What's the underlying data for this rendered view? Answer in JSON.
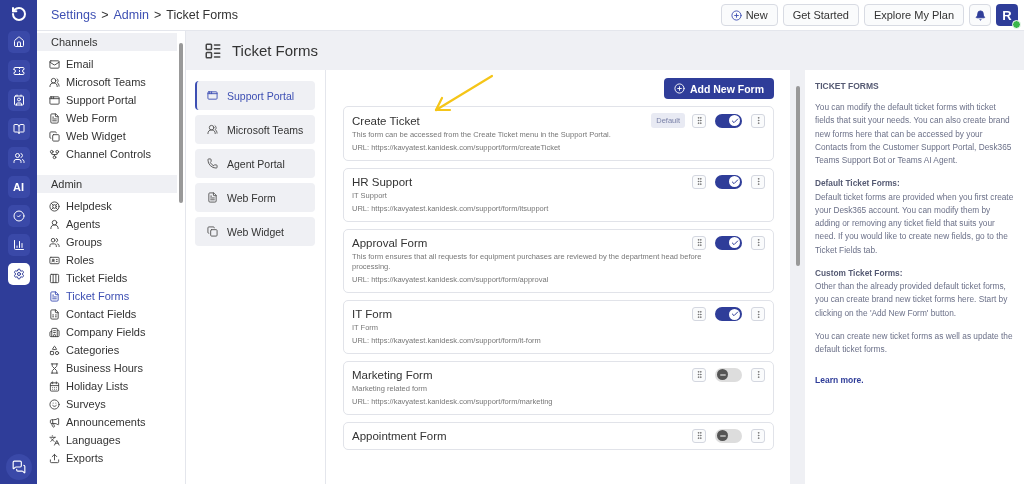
{
  "rail": {
    "items": [
      {
        "selected": false
      },
      {
        "selected": false
      },
      {
        "selected": false
      },
      {
        "selected": false
      },
      {
        "selected": false
      },
      {
        "label": "AI",
        "selected": false
      },
      {
        "selected": false
      },
      {
        "selected": false
      },
      {
        "selected": true
      }
    ]
  },
  "breadcrumb": [
    {
      "label": "Settings",
      "link": true
    },
    {
      "label": ">",
      "link": false
    },
    {
      "label": "Admin",
      "link": true
    },
    {
      "label": ">",
      "link": false
    },
    {
      "label": "Ticket Forms",
      "link": false
    }
  ],
  "topbar": {
    "buttons": [
      "New",
      "Get Started",
      "Explore My Plan"
    ],
    "avatar": "R"
  },
  "sidebar": {
    "sections": [
      {
        "title": "Channels",
        "items": [
          {
            "label": "Email",
            "selected": false
          },
          {
            "label": "Microsoft Teams",
            "selected": false
          },
          {
            "label": "Support Portal",
            "selected": false
          },
          {
            "label": "Web Form",
            "selected": false
          },
          {
            "label": "Web Widget",
            "selected": false
          },
          {
            "label": "Channel Controls",
            "selected": false
          }
        ]
      },
      {
        "title": "Admin",
        "items": [
          {
            "label": "Helpdesk",
            "selected": false
          },
          {
            "label": "Agents",
            "selected": false
          },
          {
            "label": "Groups",
            "selected": false
          },
          {
            "label": "Roles",
            "selected": false
          },
          {
            "label": "Ticket Fields",
            "selected": false
          },
          {
            "label": "Ticket Forms",
            "selected": true
          },
          {
            "label": "Contact Fields",
            "selected": false
          },
          {
            "label": "Company Fields",
            "selected": false
          },
          {
            "label": "Categories",
            "selected": false
          },
          {
            "label": "Business Hours",
            "selected": false
          },
          {
            "label": "Holiday Lists",
            "selected": false
          },
          {
            "label": "Surveys",
            "selected": false
          },
          {
            "label": "Announcements",
            "selected": false
          },
          {
            "label": "Languages",
            "selected": false
          },
          {
            "label": "Exports",
            "selected": false
          }
        ]
      }
    ]
  },
  "page": {
    "title": "Ticket Forms"
  },
  "tabs": [
    {
      "label": "Support Portal",
      "selected": true
    },
    {
      "label": "Microsoft Teams",
      "selected": false
    },
    {
      "label": "Agent Portal",
      "selected": false
    },
    {
      "label": "Web Form",
      "selected": false
    },
    {
      "label": "Web Widget",
      "selected": false
    }
  ],
  "add_button": "Add New Form",
  "forms": [
    {
      "title": "Create Ticket",
      "description": "This form can be accessed from the Create Ticket menu in the Support Portal.",
      "url": "URL: https://kavyatest.kanidesk.com/support/form/createTicket",
      "badge": "Default",
      "on": true
    },
    {
      "title": "HR Support",
      "description": "IT Support",
      "url": "URL: https://kavyatest.kanidesk.com/support/form/itsupport",
      "on": true
    },
    {
      "title": "Approval Form",
      "description": "This form ensures that all requests for equipment purchases are reviewed by the department head before processing.",
      "url": "URL: https://kavyatest.kanidesk.com/support/form/approval",
      "on": true
    },
    {
      "title": "IT Form",
      "description": "IT Form",
      "url": "URL: https://kavyatest.kanidesk.com/support/form/it-form",
      "on": true
    },
    {
      "title": "Marketing Form",
      "description": "Marketing related form",
      "url": "URL: https://kavyatest.kanidesk.com/support/form/marketing",
      "on": false
    },
    {
      "title": "Appointment Form",
      "on": false
    }
  ],
  "info": {
    "heading": "TICKET FORMS",
    "blocks": [
      {
        "kind": "para",
        "text": "You can modify the default ticket forms with ticket fields that suit your needs. You can also create brand new forms here that can be accessed by your Contacts from the Customer Support Portal, Desk365 Teams Support Bot or Teams AI Agent."
      },
      {
        "kind": "subhead",
        "text": "Default Ticket Forms:"
      },
      {
        "kind": "para",
        "text": "Default ticket forms are provided when you first create your Desk365 account. You can modify them by adding or removing any ticket field that suits your need. If you would like to create new fields, go to the Ticket Fields tab."
      },
      {
        "kind": "subhead",
        "text": "Custom Ticket Forms:"
      },
      {
        "kind": "para",
        "text": "Other than the already provided default ticket forms, you can create brand new ticket forms here. Start by clicking on the 'Add New Form' button."
      },
      {
        "kind": "para",
        "text": "You can create new ticket forms as well as update the default ticket forms."
      },
      {
        "kind": "link",
        "text": "Learn more."
      }
    ]
  }
}
